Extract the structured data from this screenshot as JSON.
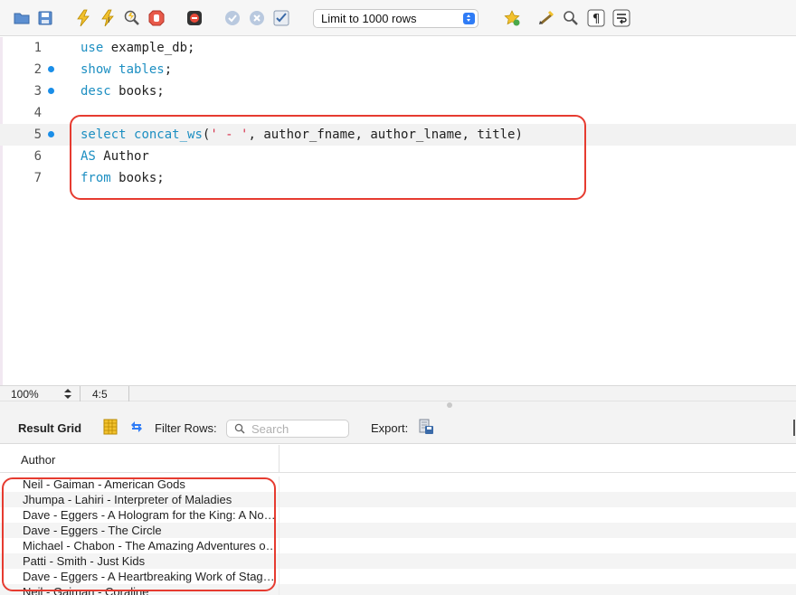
{
  "toolbar": {
    "icons": [
      "open-folder-icon",
      "save-icon",
      "execute-icon",
      "execute-current-icon",
      "explain-icon",
      "stop-icon",
      "toggle-error-icon",
      "commit-icon",
      "rollback-icon",
      "autocommit-icon",
      "bookmark-icon",
      "beautify-icon",
      "find-icon",
      "invisible-chars-icon",
      "wrap-icon"
    ],
    "limit_select": "Limit to 1000 rows"
  },
  "editor": {
    "lines": [
      {
        "number": "1",
        "text": "use example_db;"
      },
      {
        "number": "2",
        "text": "show tables;"
      },
      {
        "number": "3",
        "text": "desc books;"
      },
      {
        "number": "4",
        "text": ""
      },
      {
        "number": "5",
        "text": "select concat_ws(' - ', author_fname, author_lname, title)"
      },
      {
        "number": "6",
        "text": "AS Author"
      },
      {
        "number": "7",
        "text": "from books;"
      }
    ]
  },
  "statusbar": {
    "zoom": "100%",
    "cursor_position": "4:5"
  },
  "result": {
    "grid_label": "Result Grid",
    "filter_label": "Filter Rows:",
    "search_placeholder": "Search",
    "export_label": "Export:",
    "column_header": "Author",
    "rows": [
      "Neil - Gaiman - American Gods",
      "Jhumpa - Lahiri - Interpreter of Maladies",
      "Dave - Eggers - A Hologram for the King: A Novel",
      "Dave - Eggers - The Circle",
      "Michael - Chabon - The Amazing Adventures of Kavalier & Clay",
      "Patti - Smith - Just Kids",
      "Dave - Eggers - A Heartbreaking Work of Staggering Genius",
      "Neil - Gaiman - Coraline"
    ]
  },
  "colors": {
    "annotation_red": "#e63b30",
    "keyword_blue": "#1d8fc2",
    "string_red": "#d6304a",
    "breakpoint_blue": "#1a8ee8"
  }
}
